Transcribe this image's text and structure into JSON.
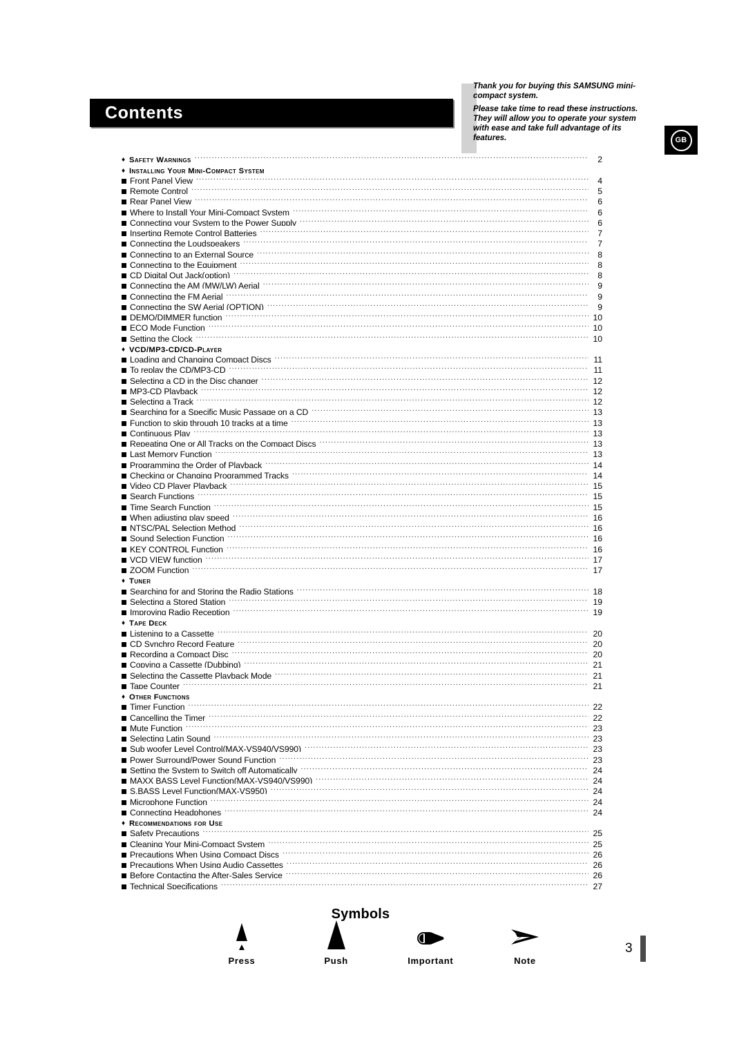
{
  "header": {
    "title": "Contents"
  },
  "intro": {
    "paragraph1": "Thank you for buying this SAMSUNG mini-compact system.",
    "paragraph2": "Please take time to read these instructions. They will allow you to operate your system with ease and take full advantage of its features."
  },
  "region_badge": {
    "label": "GB"
  },
  "toc": {
    "rows": [
      {
        "type": "section",
        "label": "Safety Warnings",
        "page": "2"
      },
      {
        "type": "section",
        "label": "Installing Your Mini-Compact System",
        "page": ""
      },
      {
        "type": "entry",
        "label": "Front Panel View",
        "page": "4"
      },
      {
        "type": "entry",
        "label": "Remote Control",
        "page": "5"
      },
      {
        "type": "entry",
        "label": "Rear Panel View",
        "page": "6"
      },
      {
        "type": "entry",
        "label": "Where to Install Your Mini-Compact System",
        "page": "6"
      },
      {
        "type": "entry",
        "label": "Connecting your System to the Power Supply",
        "page": "6"
      },
      {
        "type": "entry",
        "label": "Inserting Remote Control Batteries",
        "page": "7"
      },
      {
        "type": "entry",
        "label": "Connecting the Loudspeakers",
        "page": "7"
      },
      {
        "type": "entry",
        "label": "Connecting to an External Source",
        "page": "8"
      },
      {
        "type": "entry",
        "label": "Connecting to the Equipment",
        "page": "8"
      },
      {
        "type": "entry",
        "label": "CD Digital Out Jack(option)",
        "page": "8"
      },
      {
        "type": "entry",
        "label": "Connecting the AM (MW/LW) Aerial",
        "page": "9"
      },
      {
        "type": "entry",
        "label": "Connecting the FM Aerial",
        "page": "9"
      },
      {
        "type": "entry",
        "label": "Connecting the SW Aerial (OPTION)",
        "page": "9"
      },
      {
        "type": "entry",
        "label": "DEMO/DIMMER function",
        "page": "10"
      },
      {
        "type": "entry",
        "label": "ECO Mode Function",
        "page": "10"
      },
      {
        "type": "entry",
        "label": "Setting the Clock",
        "page": "10"
      },
      {
        "type": "section",
        "label": "VCD/MP3-CD/CD-Player",
        "page": ""
      },
      {
        "type": "entry",
        "label": "Loading and Changing Compact Discs",
        "page": "11"
      },
      {
        "type": "entry",
        "label": "To replay the CD/MP3-CD",
        "page": "11"
      },
      {
        "type": "entry",
        "label": "Selecting a CD in the Disc changer",
        "page": "12"
      },
      {
        "type": "entry",
        "label": "MP3-CD Playback",
        "page": "12"
      },
      {
        "type": "entry",
        "label": "Selecting a Track",
        "page": "12"
      },
      {
        "type": "entry",
        "label": "Searching for a Specific Music Passage on a CD",
        "page": "13"
      },
      {
        "type": "entry",
        "label": "Function to skip through 10 tracks at a time",
        "page": "13"
      },
      {
        "type": "entry",
        "label": "Continuous Play",
        "page": "13"
      },
      {
        "type": "entry",
        "label": "Repeating One or All Tracks on the Compact Discs",
        "page": "13"
      },
      {
        "type": "entry",
        "label": "Last Memory Function",
        "page": "13"
      },
      {
        "type": "entry",
        "label": "Programming the Order of Playback",
        "page": "14"
      },
      {
        "type": "entry",
        "label": "Checking or Changing Programmed Tracks",
        "page": "14"
      },
      {
        "type": "entry",
        "label": "Video CD Player Playback",
        "page": "15"
      },
      {
        "type": "entry",
        "label": "Search Functions",
        "page": "15"
      },
      {
        "type": "entry",
        "label": "Time Search Function",
        "page": "15"
      },
      {
        "type": "entry",
        "label": "When adjusting play speed",
        "page": "16"
      },
      {
        "type": "entry",
        "label": "NTSC/PAL Selection Method",
        "page": "16"
      },
      {
        "type": "entry",
        "label": "Sound Selection Function",
        "page": "16"
      },
      {
        "type": "entry",
        "label": "KEY CONTROL Function",
        "page": "16"
      },
      {
        "type": "entry",
        "label": "VCD VIEW function",
        "page": "17"
      },
      {
        "type": "entry",
        "label": "ZOOM Function",
        "page": "17"
      },
      {
        "type": "section",
        "label": "Tuner",
        "page": ""
      },
      {
        "type": "entry",
        "label": "Searching for and Storing the Radio Stations",
        "page": "18"
      },
      {
        "type": "entry",
        "label": "Selecting a Stored Station",
        "page": "19"
      },
      {
        "type": "entry",
        "label": "Improving Radio Reception",
        "page": "19"
      },
      {
        "type": "section",
        "label": "Tape Deck",
        "page": ""
      },
      {
        "type": "entry",
        "label": "Listening to a Cassette",
        "page": "20"
      },
      {
        "type": "entry",
        "label": "CD Synchro Record Feature",
        "page": "20"
      },
      {
        "type": "entry",
        "label": "Recording a Compact Disc",
        "page": "20"
      },
      {
        "type": "entry",
        "label": "Copying a Cassette (Dubbing)",
        "page": "21"
      },
      {
        "type": "entry",
        "label": "Selecting the Cassette Playback Mode",
        "page": "21"
      },
      {
        "type": "entry",
        "label": "Tape Counter",
        "page": "21"
      },
      {
        "type": "section",
        "label": "Other Functions",
        "page": ""
      },
      {
        "type": "entry",
        "label": "Timer Function",
        "page": "22"
      },
      {
        "type": "entry",
        "label": "Cancelling the Timer",
        "page": "22"
      },
      {
        "type": "entry",
        "label": "Mute Function",
        "page": "23"
      },
      {
        "type": "entry",
        "label": "Selecting Latin Sound",
        "page": "23"
      },
      {
        "type": "entry",
        "label": "Sub woofer Level Control(MAX-VS940/VS990)",
        "page": "23"
      },
      {
        "type": "entry",
        "label": "Power Surround/Power Sound Function",
        "page": "23"
      },
      {
        "type": "entry",
        "label": "Setting the System to Switch off Automatically",
        "page": "24"
      },
      {
        "type": "entry",
        "label": "MAXX BASS Level Function(MAX-VS940/VS990)",
        "page": "24"
      },
      {
        "type": "entry",
        "label": "S.BASS Level Function(MAX-VS950)",
        "page": "24"
      },
      {
        "type": "entry",
        "label": "Microphone Function",
        "page": "24"
      },
      {
        "type": "entry",
        "label": "Connecting Headphones",
        "page": "24"
      },
      {
        "type": "section",
        "label": "Recommendations for Use",
        "page": ""
      },
      {
        "type": "entry",
        "label": "Safety Precautions",
        "page": "25"
      },
      {
        "type": "entry",
        "label": "Cleaning Your Mini-Compact System",
        "page": "25"
      },
      {
        "type": "entry",
        "label": "Precautions When Using Compact Discs",
        "page": "26"
      },
      {
        "type": "entry",
        "label": "Precautions When Using Audio Cassettes",
        "page": "26"
      },
      {
        "type": "entry",
        "label": "Before Contacting the After-Sales Service",
        "page": "26"
      },
      {
        "type": "entry",
        "label": "Technical Specifications",
        "page": "27"
      }
    ]
  },
  "symbols": {
    "title": "Symbols",
    "items": [
      {
        "icon": "press-triangle-icon",
        "caption": "Press"
      },
      {
        "icon": "push-triangle-icon",
        "caption": "Push"
      },
      {
        "icon": "pointing-hand-icon",
        "caption": "Important"
      },
      {
        "icon": "arrow-chevron-icon",
        "caption": "Note"
      }
    ]
  },
  "footer": {
    "page_number": "3"
  }
}
